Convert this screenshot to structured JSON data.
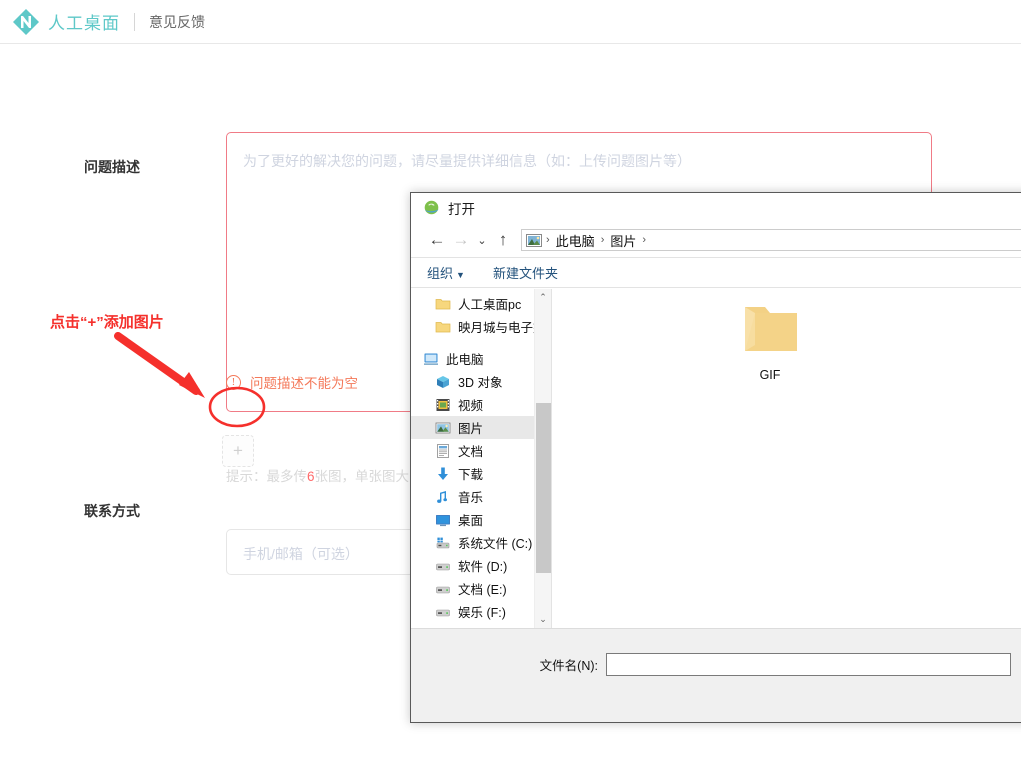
{
  "header": {
    "brand": "人工桌面",
    "nav_link": "意见反馈",
    "brand_color": "#5ec8c8"
  },
  "form": {
    "description": {
      "label": "问题描述",
      "placeholder": "为了更好的解决您的问题，请尽量提供详细信息（如：上传问题图片等）",
      "value": "",
      "error": "问题描述不能为空",
      "error_color": "#f4795a",
      "border_color": "#f07b86"
    },
    "upload": {
      "plus_label": "+",
      "hint_prefix": "提示：最多传",
      "hint_number": "6",
      "hint_suffix": "张图，单张图大"
    },
    "contact": {
      "label": "联系方式",
      "placeholder": "手机/邮箱（可选）",
      "value": ""
    }
  },
  "annotation": {
    "text": "点击“+”添加图片",
    "color": "#f5302c"
  },
  "dialog": {
    "title": "打开",
    "title_icon": "internet-explorer-icon",
    "nav": {
      "back": "←",
      "forward": "→",
      "recent": "⌄",
      "up": "↑",
      "breadcrumbs": [
        "此电脑",
        "图片"
      ],
      "separator": "›"
    },
    "toolbar": {
      "organize": "组织",
      "organize_caret": "▼",
      "new_folder": "新建文件夹"
    },
    "sidebar": [
      {
        "label": "人工桌面pc",
        "icon": "folder-icon",
        "type": "quick",
        "selected": false
      },
      {
        "label": "映月城与电子姬",
        "icon": "folder-icon",
        "type": "quick",
        "selected": false
      },
      {
        "label": "此电脑",
        "icon": "computer-icon",
        "type": "root",
        "selected": false
      },
      {
        "label": "3D 对象",
        "icon": "3d-objects-icon",
        "type": "child",
        "selected": false
      },
      {
        "label": "视频",
        "icon": "videos-icon",
        "type": "child",
        "selected": false
      },
      {
        "label": "图片",
        "icon": "pictures-icon",
        "type": "child",
        "selected": true
      },
      {
        "label": "文档",
        "icon": "documents-icon",
        "type": "child",
        "selected": false
      },
      {
        "label": "下载",
        "icon": "downloads-icon",
        "type": "child",
        "selected": false
      },
      {
        "label": "音乐",
        "icon": "music-icon",
        "type": "child",
        "selected": false
      },
      {
        "label": "桌面",
        "icon": "desktop-icon",
        "type": "child",
        "selected": false
      },
      {
        "label": "系统文件 (C:)",
        "icon": "system-drive-icon",
        "type": "child",
        "selected": false
      },
      {
        "label": "软件 (D:)",
        "icon": "drive-icon",
        "type": "child",
        "selected": false
      },
      {
        "label": "文档 (E:)",
        "icon": "drive-icon",
        "type": "child",
        "selected": false
      },
      {
        "label": "娱乐 (F:)",
        "icon": "drive-icon",
        "type": "child",
        "selected": false
      }
    ],
    "files": [
      {
        "name": "GIF",
        "icon": "folder-icon"
      }
    ],
    "footer": {
      "filename_label": "文件名(N):",
      "filename_value": ""
    },
    "scrollbar": {
      "up_arrow": "⌃",
      "down_arrow": "⌄"
    }
  }
}
